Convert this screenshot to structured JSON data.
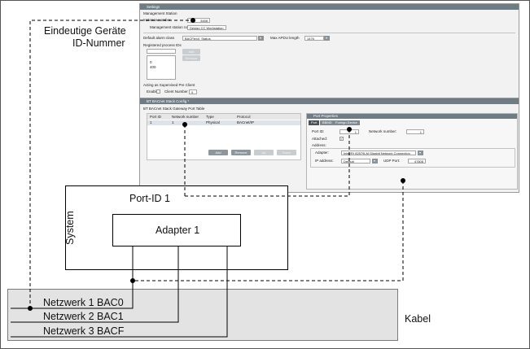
{
  "settings": {
    "header": "Settings",
    "section_title": "Management Station",
    "instance_number_label": "Instance number",
    "instance_number_value": "3458",
    "station_name_label": "Management station name",
    "station_name_value": "Desigo CC Workstation",
    "alarm_class_label": "Default alarm class",
    "alarm_class_value": "BACFlex4_Status_",
    "apdu_label": "Max APDU length",
    "apdu_value": "1476",
    "process_ids_label": "Registered process IDs",
    "process_ids": [
      "0",
      "400"
    ],
    "add_button": "Add",
    "remove_button": "Remove",
    "supervised_label": "Acting as Supervised Pre Client",
    "enable_label": "Enable",
    "client_number_label": "Client Number",
    "client_number_value": "0"
  },
  "stack_config": {
    "header": "BT BACnet Stack Config *",
    "table_title": "BT BACnet Stack Gateway Port Table",
    "columns": [
      "Port ID",
      "Network number",
      "Type",
      "Protocol"
    ],
    "rows": [
      {
        "port_id": "1",
        "network_number": "1",
        "type": "Physical",
        "protocol": "BACnet/IP"
      }
    ],
    "buttons": [
      "Add",
      "Remove",
      "Up",
      "Down"
    ]
  },
  "port_properties": {
    "header": "Port Properties",
    "tabs": [
      "Port",
      "BBMD",
      "Foreign Device"
    ],
    "port_id_label": "Port ID:",
    "port_id_value": "1",
    "network_number_label": "Network number:",
    "network_number_value": "1",
    "attached_label": "Attached:",
    "address_label": "Address:",
    "adapter_label": "Adapter:",
    "adapter_value": "Intel(R) 82579LM Gigabit Network Connection",
    "ip_address_label": "IP address:",
    "ip_address_value": "Default",
    "udp_port_label": "UDP Port:",
    "udp_port_value": "47808"
  },
  "annotations": {
    "device_id_line1": "Eindeutige Geräte",
    "device_id_line2": "ID-Nummer",
    "port_id": "Port-ID 1",
    "system": "System",
    "adapter": "Adapter 1",
    "cable": "Kabel",
    "networks": [
      "Netzwerk 1 BAC0",
      "Netzwerk 2 BAC1",
      "Netzwerk 3 BACF"
    ]
  }
}
